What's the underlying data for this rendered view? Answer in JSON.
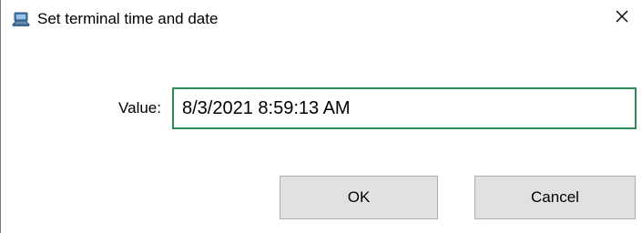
{
  "window": {
    "title": "Set terminal time and date",
    "icon": "terminal-app-icon",
    "close_icon": "close-icon"
  },
  "form": {
    "value_label": "Value:",
    "value": "8/3/2021 8:59:13 AM"
  },
  "buttons": {
    "ok_label": "OK",
    "cancel_label": "Cancel"
  },
  "colors": {
    "input_focus_border": "#2e8b57",
    "button_background": "#e1e1e1",
    "button_border": "#adadad"
  }
}
